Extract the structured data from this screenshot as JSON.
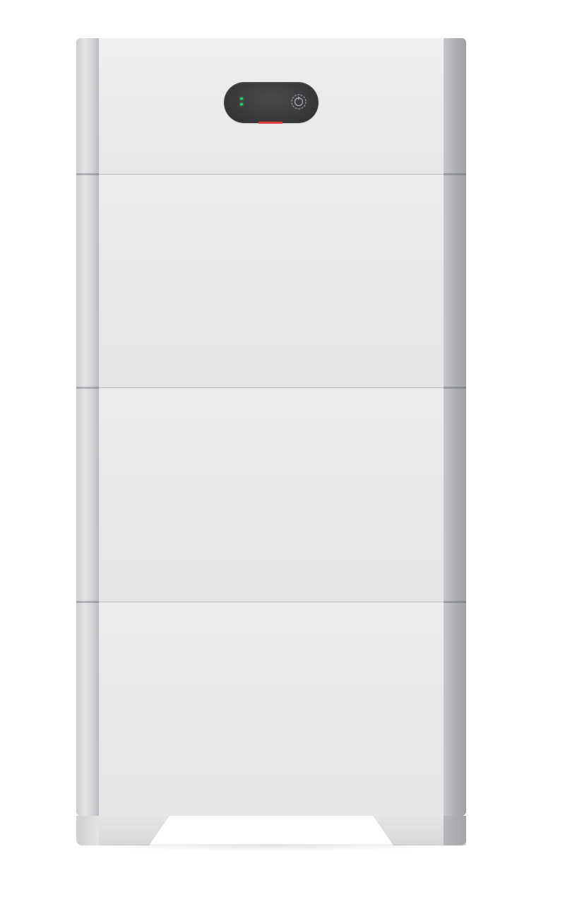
{
  "product": {
    "modules": [
      {
        "role": "control-module"
      },
      {
        "role": "battery-module"
      },
      {
        "role": "battery-module"
      },
      {
        "role": "battery-module"
      }
    ],
    "display": {
      "status_leds": [
        "green",
        "green"
      ],
      "icon": "power-button-icon",
      "indicator": "red"
    },
    "colors": {
      "body": "#e8e8e9",
      "rail": "#c9cbcd",
      "display": "#3a3a3c",
      "led": "#2fd07a",
      "indicator": "#e03a3a"
    }
  }
}
